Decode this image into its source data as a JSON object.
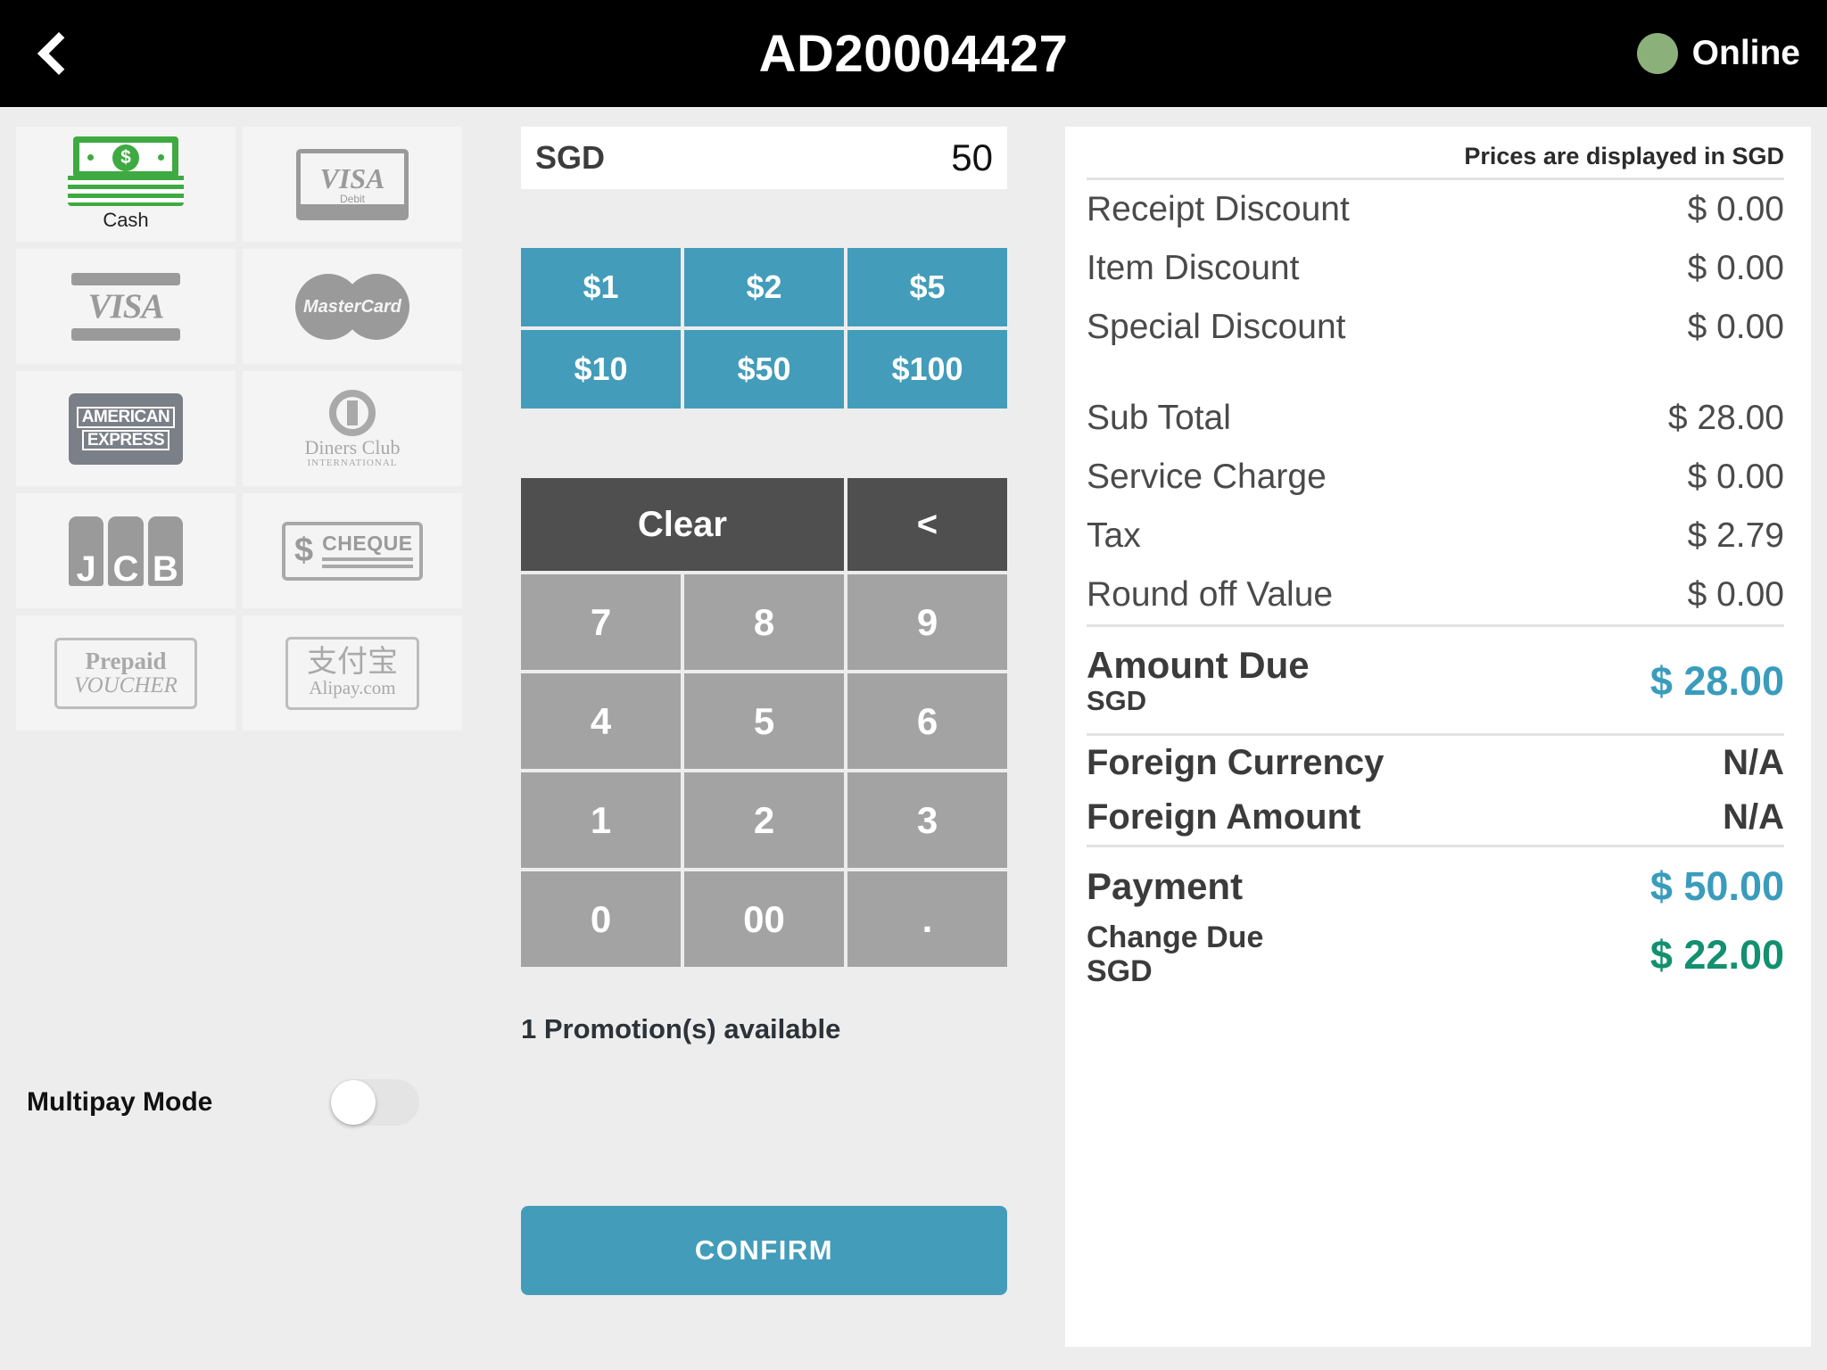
{
  "header": {
    "back_icon": "back-chevron-icon",
    "order_id": "AD20004427",
    "status_label": "Online",
    "status_color": "#8cb07a"
  },
  "payment_methods": [
    {
      "name": "Cash",
      "label": "Cash",
      "icon": "cash-icon",
      "selected": true
    },
    {
      "name": "Visa Debit",
      "label": "",
      "icon": "visa-debit-card-icon",
      "selected": false
    },
    {
      "name": "Visa",
      "label": "",
      "icon": "visa-card-icon",
      "selected": false
    },
    {
      "name": "MasterCard",
      "label": "",
      "icon": "mastercard-icon",
      "selected": false
    },
    {
      "name": "American Express",
      "label": "",
      "icon": "amex-card-icon",
      "selected": false
    },
    {
      "name": "Diners Club",
      "label": "",
      "icon": "diners-club-icon",
      "selected": false
    },
    {
      "name": "JCB",
      "label": "",
      "icon": "jcb-card-icon",
      "selected": false
    },
    {
      "name": "Cheque",
      "label": "",
      "icon": "cheque-icon",
      "selected": false
    },
    {
      "name": "Prepaid Voucher",
      "label": "",
      "icon": "prepaid-voucher-icon",
      "selected": false
    },
    {
      "name": "Alipay",
      "label": "",
      "icon": "alipay-icon",
      "selected": false
    }
  ],
  "card_text": {
    "visa": "VISA",
    "visa_debit_sub": "Debit",
    "mastercard": "MasterCard",
    "amex_line1": "AMERICAN",
    "amex_line2": "EXPRESS",
    "diners_line1": "Diners Club",
    "diners_line2": "INTERNATIONAL",
    "jcb_j": "J",
    "jcb_c": "C",
    "jcb_b": "B",
    "cheque_dollar": "$",
    "cheque_word": "CHEQUE",
    "voucher_line1": "Prepaid",
    "voucher_line2": "VOUCHER",
    "alipay_cn": "支付宝",
    "alipay_en": "Alipay.com"
  },
  "multipay": {
    "label": "Multipay Mode",
    "enabled": false
  },
  "amount_input": {
    "currency": "SGD",
    "value": "50",
    "placeholder": "0"
  },
  "quick_amounts": [
    "$1",
    "$2",
    "$5",
    "$10",
    "$50",
    "$100"
  ],
  "keypad": {
    "clear_label": "Clear",
    "backspace_label": "<",
    "keys": [
      "7",
      "8",
      "9",
      "4",
      "5",
      "6",
      "1",
      "2",
      "3",
      "0",
      "00",
      "."
    ]
  },
  "promotion": {
    "text": "1 Promotion(s) available"
  },
  "confirm": {
    "label": "CONFIRM"
  },
  "summary": {
    "note": "Prices are displayed in SGD",
    "rows": [
      {
        "label": "Receipt Discount",
        "value": "$ 0.00"
      },
      {
        "label": "Item Discount",
        "value": "$ 0.00"
      },
      {
        "label": "Special Discount",
        "value": "$ 0.00"
      }
    ],
    "rows2": [
      {
        "label": "Sub Total",
        "value": "$ 28.00"
      },
      {
        "label": "Service Charge",
        "value": "$ 0.00"
      },
      {
        "label": "Tax",
        "value": "$ 2.79"
      },
      {
        "label": "Round off Value",
        "value": "$ 0.00"
      }
    ],
    "amount_due": {
      "label": "Amount Due",
      "sub": "SGD",
      "value": "$ 28.00"
    },
    "foreign_currency": {
      "label": "Foreign Currency",
      "value": "N/A"
    },
    "foreign_amount": {
      "label": "Foreign Amount",
      "value": "N/A"
    },
    "payment": {
      "label": "Payment",
      "value": "$ 50.00"
    },
    "change_due": {
      "label": "Change Due",
      "sub": "SGD",
      "value": "$ 22.00"
    }
  },
  "colors": {
    "accent": "#439cba",
    "amount_due": "#3a9cbd",
    "change_due": "#13906f",
    "keypad_dark": "#4f4f4f",
    "keypad_light": "#a3a3a3",
    "online": "#8cb07a"
  }
}
